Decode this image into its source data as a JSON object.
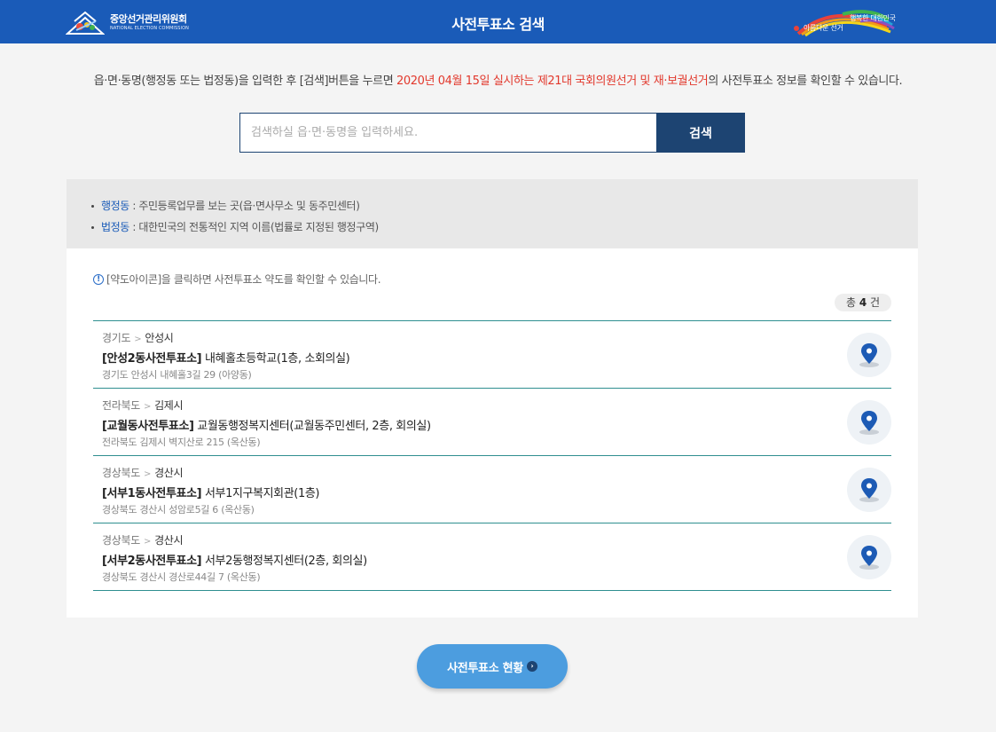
{
  "header": {
    "logo_ko": "중앙선거관리위원회",
    "logo_en": "NATIONAL ELECTION COMMISSION",
    "title": "사전투표소 검색",
    "slogan1": "행복한 대한민국",
    "slogan2": "아름다운 선거"
  },
  "intro": {
    "before": "읍·면·동명(행정동 또는 법정동)을 입력한 후 [검색]버튼을 누르면 ",
    "highlight": "2020년 04월 15일 실시하는 제21대 국회의원선거 및 재·보궐선거",
    "after": "의 사전투표소 정보를 확인할 수 있습니다."
  },
  "search": {
    "placeholder": "검색하실 읍·면·동명을 입력하세요.",
    "value": "",
    "button_label": "검색"
  },
  "info": {
    "items": [
      {
        "term": "행정동",
        "desc": " : 주민등록업무를 보는 곳(읍·면사무소 및 동주민센터)"
      },
      {
        "term": "법정동",
        "desc": " : 대한민국의 전통적인 지역 이름(법률로 지정된 행정구역)"
      }
    ]
  },
  "results": {
    "notice_icon": "!",
    "notice": "[약도아이콘]을 클릭하면 사전투표소 약도를 확인할 수 있습니다.",
    "count_prefix": "총 ",
    "count": "4",
    "count_suffix": " 건",
    "separator": ">",
    "items": [
      {
        "province": "경기도",
        "city": "안성시",
        "station": "[안성2동사전투표소]",
        "place": " 내혜홀초등학교(1층, 소회의실)",
        "address": "경기도 안성시 내혜홀3길 29 (아양동)"
      },
      {
        "province": "전라북도",
        "city": "김제시",
        "station": "[교월동사전투표소]",
        "place": " 교월동행정복지센터(교월동주민센터, 2층, 회의실)",
        "address": "전라북도 김제시 벽지산로 215 (옥산동)"
      },
      {
        "province": "경상북도",
        "city": "경산시",
        "station": "[서부1동사전투표소]",
        "place": " 서부1지구복지회관(1층)",
        "address": "경상북도 경산시 성암로5길 6 (옥산동)"
      },
      {
        "province": "경상북도",
        "city": "경산시",
        "station": "[서부2동사전투표소]",
        "place": " 서부2동행정복지센터(2층, 회의실)",
        "address": "경상북도 경산시 경산로44길 7 (옥산동)"
      }
    ],
    "map_icon": "map-pin-icon"
  },
  "bottom": {
    "status_label": "사전투표소 현황",
    "arrow_glyph": "›"
  },
  "colors": {
    "header_bg": "#1a5bb8",
    "search_button": "#1d4472",
    "highlight": "#e2382c",
    "divider": "#2f8f90",
    "status_button": "#4c9ddf"
  }
}
